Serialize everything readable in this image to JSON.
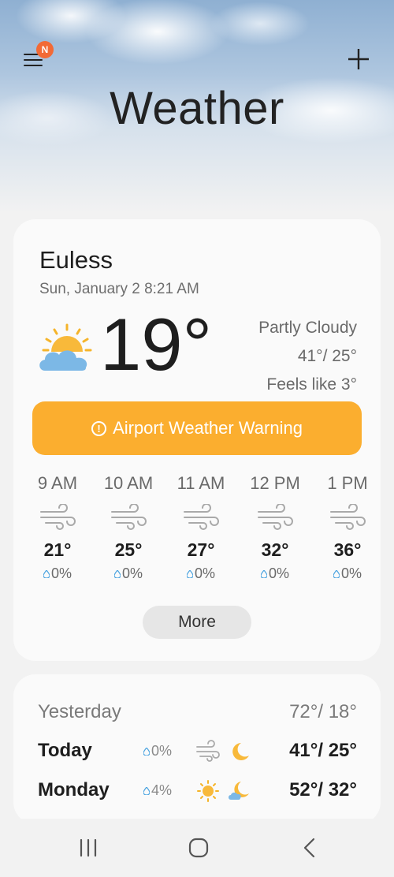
{
  "header": {
    "title": "Weather",
    "notification_badge": "N",
    "badge_color": "#f26a36"
  },
  "current": {
    "city": "Euless",
    "datetime": "Sun, January 2 8:21 AM",
    "temperature": "19°",
    "condition": "Partly Cloudy",
    "hi_lo": "41°/ 25°",
    "feels_like": "Feels like 3°",
    "condition_icon": "partly-cloudy-icon",
    "warning": {
      "label": "Airport Weather Warning",
      "color": "#fbae2f"
    },
    "hourly": [
      {
        "time": "9 AM",
        "temp": "21°",
        "precip": "0%",
        "icon": "wind-icon"
      },
      {
        "time": "10 AM",
        "temp": "25°",
        "precip": "0%",
        "icon": "wind-icon"
      },
      {
        "time": "11 AM",
        "temp": "27°",
        "precip": "0%",
        "icon": "wind-icon"
      },
      {
        "time": "12 PM",
        "temp": "32°",
        "precip": "0%",
        "icon": "wind-icon"
      },
      {
        "time": "1 PM",
        "temp": "36°",
        "precip": "0%",
        "icon": "wind-icon"
      }
    ],
    "more_label": "More"
  },
  "forecast": {
    "rows": [
      {
        "day": "Yesterday",
        "precip": "",
        "hilo": "72°/ 18°"
      },
      {
        "day": "Today",
        "precip": "0%",
        "hilo": "41°/ 25°",
        "icon_day": "wind-icon",
        "icon_night": "moon-icon"
      },
      {
        "day": "Monday",
        "precip": "4%",
        "hilo": "52°/ 32°",
        "icon_day": "sun-icon",
        "icon_night": "cloudy-moon-icon"
      }
    ]
  },
  "navbar": {
    "items": [
      "recent-apps-icon",
      "home-icon",
      "back-icon"
    ]
  }
}
